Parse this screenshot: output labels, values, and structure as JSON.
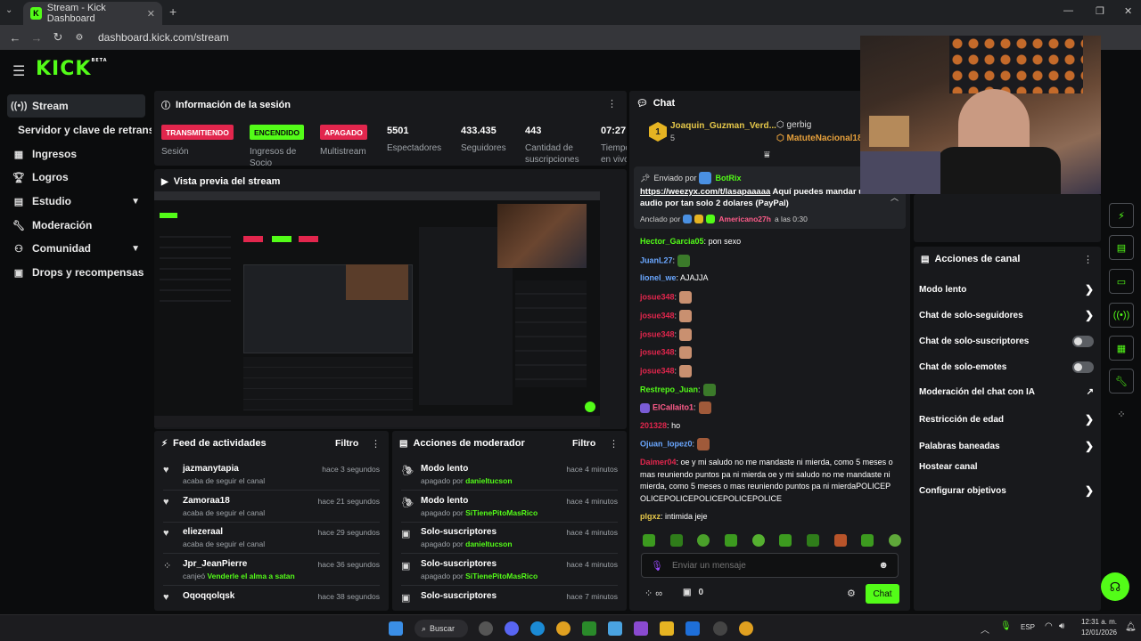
{
  "browser": {
    "tab_title": "Stream - Kick Dashboard",
    "url": "dashboard.kick.com/stream"
  },
  "site": {
    "logo": "KICK",
    "logo_beta": "BETA"
  },
  "sidebar": {
    "items": [
      {
        "label": "Stream",
        "icon": "broadcast-icon"
      },
      {
        "label": "Servidor y clave de retransmisión"
      },
      {
        "label": "Ingresos",
        "icon": "chart-icon"
      },
      {
        "label": "Logros",
        "icon": "trophy-icon"
      },
      {
        "label": "Estudio",
        "icon": "studio-icon"
      },
      {
        "label": "Moderación",
        "icon": "wrench-icon"
      },
      {
        "label": "Comunidad",
        "icon": "community-icon"
      },
      {
        "label": "Drops y recompensas",
        "icon": "gift-icon"
      }
    ]
  },
  "session": {
    "title": "Información de la sesión",
    "badges": [
      {
        "label": "TRANSMITIENDO",
        "caption": "Sesión",
        "bg": "#e2264d",
        "fg": "#ffffff"
      },
      {
        "label": "ENCENDIDO",
        "caption": "Ingresos de Socio",
        "bg": "#53fc18",
        "fg": "#0b0c0d"
      },
      {
        "label": "APAGADO",
        "caption": "Multistream",
        "bg": "#e2264d",
        "fg": "#ffffff"
      }
    ],
    "stats": [
      {
        "value": "5501",
        "label": "Espectadores"
      },
      {
        "value": "433.435",
        "label": "Seguidores"
      },
      {
        "value": "443",
        "label": "Cantidad de suscripciones"
      },
      {
        "value": "07:27:",
        "label": "Tiempo en vivo"
      }
    ]
  },
  "preview": {
    "title": "Vista previa del stream"
  },
  "activity": {
    "title": "Feed de actividades",
    "filter": "Filtro",
    "rows": [
      {
        "icon": "heart-icon",
        "name": "jazmanytapia",
        "sub": "acaba de seguir el canal",
        "time": "hace 3 segundos"
      },
      {
        "icon": "heart-icon",
        "name": "Zamoraa18",
        "sub": "acaba de seguir el canal",
        "time": "hace 21 segundos"
      },
      {
        "icon": "heart-icon",
        "name": "eliezeraal",
        "sub": "acaba de seguir el canal",
        "time": "hace 29 segundos"
      },
      {
        "icon": "kicks-icon",
        "name": "Jpr_JeanPierre",
        "sub": "canjeó",
        "sub_highlight": "Venderle el alma a satan",
        "time": "hace 36 segundos"
      },
      {
        "icon": "heart-icon",
        "name": "Oqoqqolqsk",
        "sub": "",
        "time": "hace 38 segundos"
      }
    ]
  },
  "modactions": {
    "title": "Acciones de moderador",
    "filter": "Filtro",
    "rows": [
      {
        "icon": "snail-icon",
        "name": "Modo lento",
        "sub": "apagado por",
        "user": "danieltucson",
        "time": "hace 4 minutos"
      },
      {
        "icon": "snail-icon",
        "name": "Modo lento",
        "sub": "apagado por",
        "user": "SiTienePitoMasRico",
        "time": "hace 4 minutos"
      },
      {
        "icon": "gift-icon",
        "name": "Solo-suscriptores",
        "sub": "apagado por",
        "user": "danieltucson",
        "time": "hace 4 minutos"
      },
      {
        "icon": "gift-icon",
        "name": "Solo-suscriptores",
        "sub": "apagado por",
        "user": "SiTienePitoMasRico",
        "time": "hace 4 minutos"
      },
      {
        "icon": "gift-icon",
        "name": "Solo-suscriptores",
        "sub": "",
        "user": "",
        "time": "hace 7 minutos"
      }
    ]
  },
  "chat": {
    "title": "Chat",
    "top_gifter": {
      "rank": "1",
      "name": "Joaquin_Guzman_Verd...",
      "count": "5"
    },
    "others": [
      "gerbig",
      "MatuteNacional18"
    ],
    "pinned": {
      "sent_by_label": "Enviado por",
      "sender": "BotRix",
      "link": "https://weezyx.com/t/lasapaaaaa",
      "text": " Aquí puedes mandar un audio por tan solo 2 dolares (PayPal)",
      "pinned_by_label": "Anclado por",
      "pinned_by": "Americano27h",
      "pinned_at": "a las 0:30"
    },
    "messages": [
      {
        "user": "Hector_Garcia05",
        "color": "green",
        "text": " pon sexo"
      },
      {
        "user": "JuanL27",
        "color": "blue",
        "text": "",
        "emote": "#3b7a2a"
      },
      {
        "user": "lionel_we",
        "color": "blue",
        "text": " AJAJJA"
      },
      {
        "user": "josue348",
        "color": "red",
        "text": "",
        "emote": "#c99070"
      },
      {
        "user": "josue348",
        "color": "red",
        "text": "",
        "emote": "#c99070"
      },
      {
        "user": "josue348",
        "color": "red",
        "text": "",
        "emote": "#c99070"
      },
      {
        "user": "josue348",
        "color": "red",
        "text": "",
        "emote": "#c99070"
      },
      {
        "user": "josue348",
        "color": "red",
        "text": "",
        "emote": "#c99070"
      },
      {
        "user": "Restrepo_Juan",
        "color": "green",
        "text": "",
        "emote": "#3b7a2a"
      },
      {
        "user": "ElCallaito1",
        "color": "pink",
        "text": "",
        "emote": "#a05a3a"
      },
      {
        "user": "201328",
        "color": "red",
        "text": " ho"
      },
      {
        "user": "Ojuan_lopez0",
        "color": "blue",
        "text": "",
        "emote": "#a05a3a"
      },
      {
        "user": "Daimer04",
        "color": "red",
        "text": " oe y mi saludo no me mandaste ni mierda, como 5 meses o mas reuniendo puntos pa ni mierda oe y mi saludo no me mandaste ni mierda, como 5 meses o mas reuniendo puntos pa ni mierdaPOLICEPOLICEPOLICEPOLICEPOLICEPOLICE"
      },
      {
        "user": "plgxz",
        "color": "yel",
        "text": " intimida jeje"
      }
    ],
    "input_placeholder": "Enviar un mensaje",
    "kicks_value": "∞",
    "subs_count": "0",
    "send_label": "Chat"
  },
  "channel_actions": {
    "title": "Acciones de canal",
    "rows": [
      {
        "label": "Modo lento",
        "control": "chevron"
      },
      {
        "label": "Chat de solo-seguidores",
        "control": "chevron"
      },
      {
        "label": "Chat de solo-suscriptores",
        "control": "toggle"
      },
      {
        "label": "Chat de solo-emotes",
        "control": "toggle"
      },
      {
        "label": "Moderación del chat con IA",
        "control": "external"
      },
      {
        "label": "Restricción de edad",
        "control": "chevron"
      },
      {
        "label": "Palabras baneadas",
        "control": "chevron"
      },
      {
        "label": "Hostear canal",
        "control": "none"
      },
      {
        "label": "Configurar objetivos",
        "control": "chevron"
      }
    ]
  },
  "taskbar": {
    "search_label": "Buscar",
    "lang": "ESP",
    "time": "12:31 a. m.",
    "date": "12/01/2026"
  }
}
